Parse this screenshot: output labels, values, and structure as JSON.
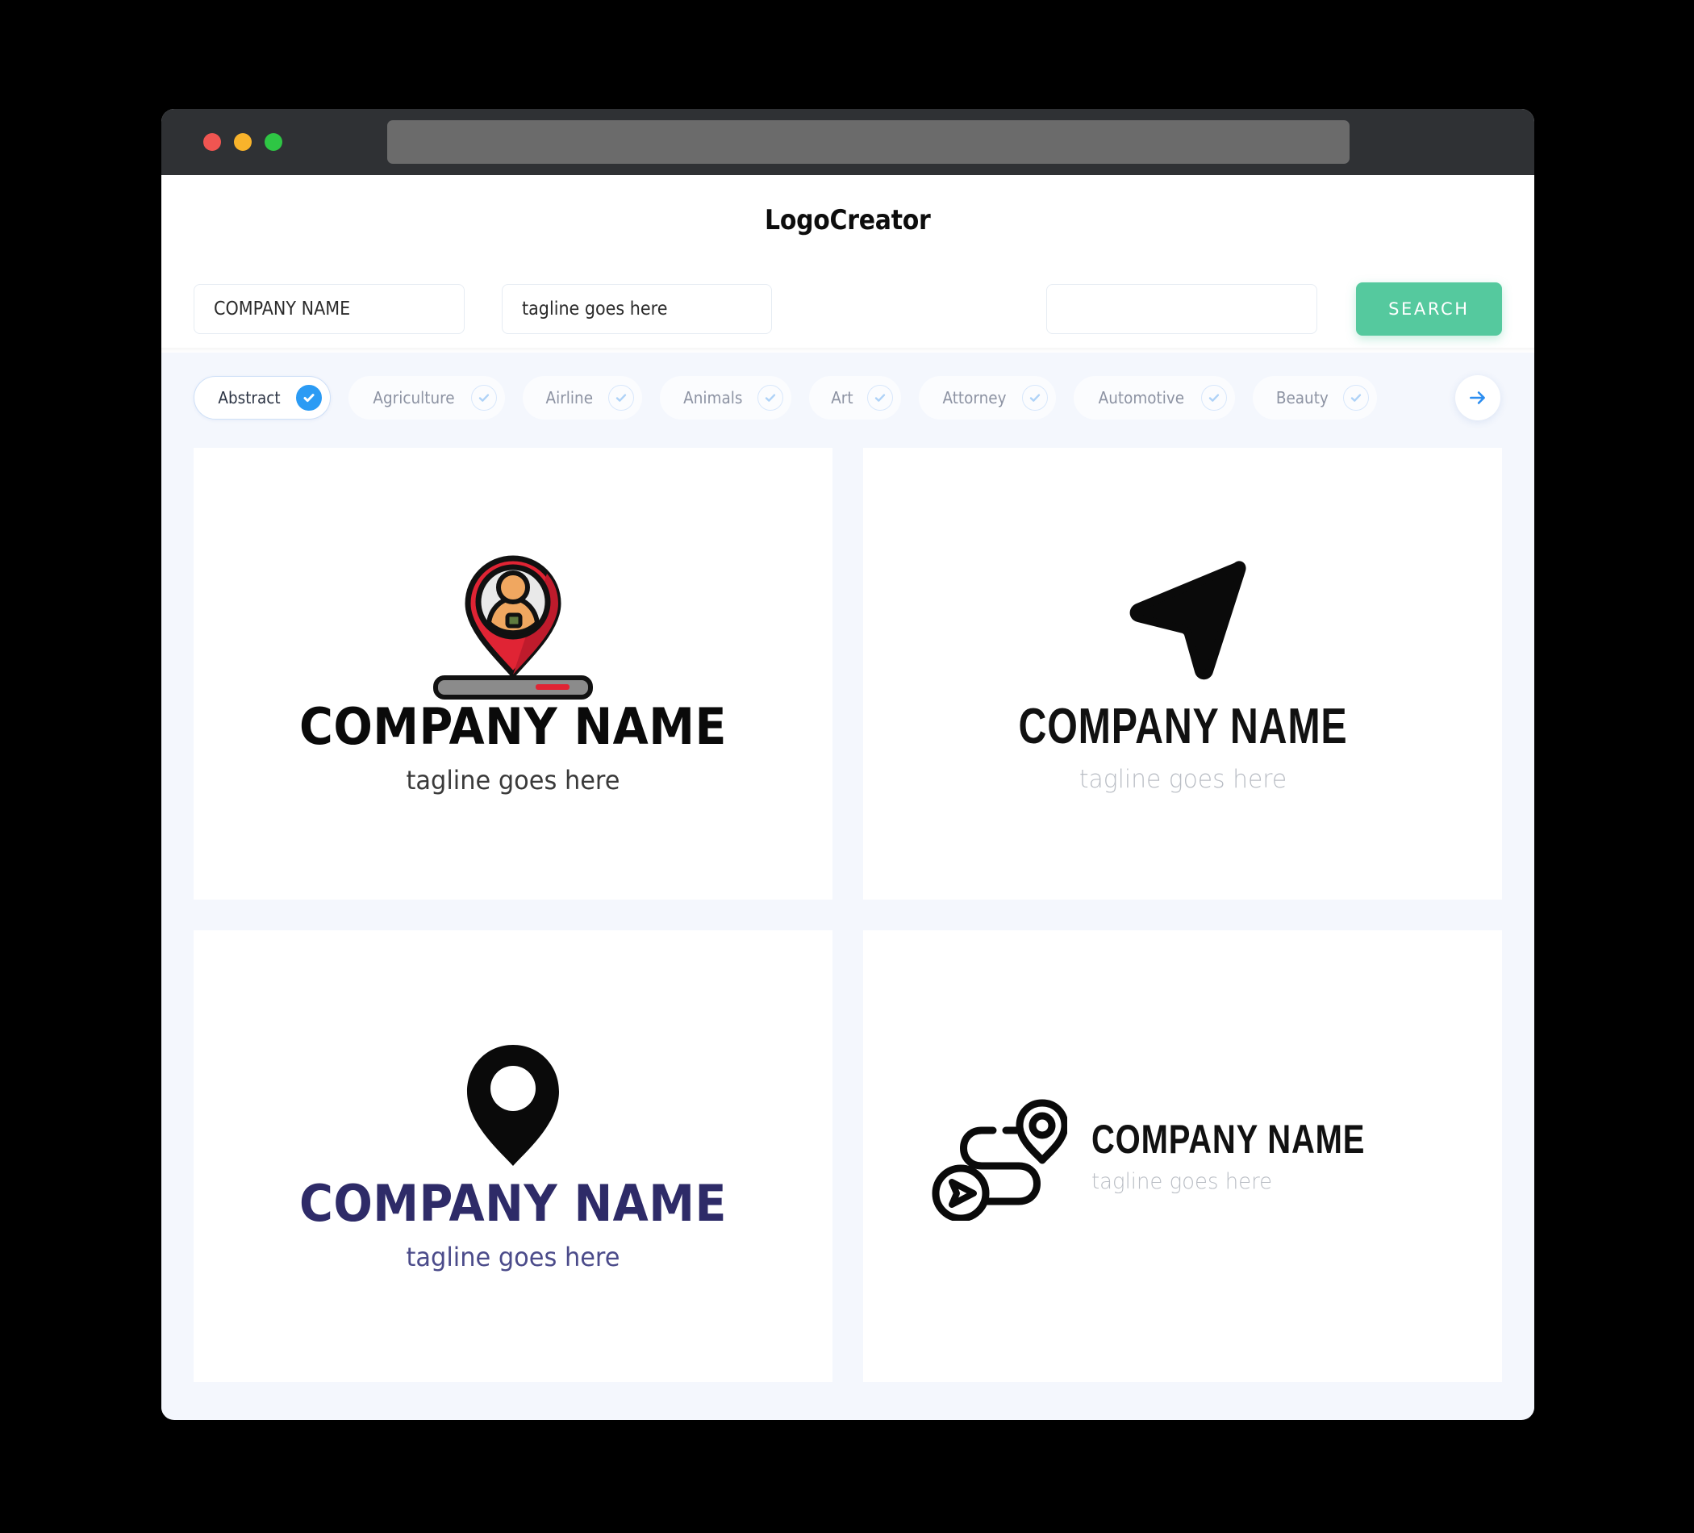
{
  "window": {
    "traffic_lights": [
      "close",
      "minimize",
      "maximize"
    ],
    "url_value": ""
  },
  "header": {
    "title": "LogoCreator"
  },
  "search": {
    "company_value": "COMPANY NAME",
    "company_placeholder": "COMPANY NAME",
    "tagline_value": "tagline goes here",
    "tagline_placeholder": "tagline goes here",
    "extra_value": "",
    "extra_placeholder": "",
    "button_label": "SEARCH",
    "button_color": "#55c99e"
  },
  "categories": {
    "items": [
      {
        "label": "Abstract",
        "selected": true
      },
      {
        "label": "Agriculture",
        "selected": false
      },
      {
        "label": "Airline",
        "selected": false
      },
      {
        "label": "Animals",
        "selected": false
      },
      {
        "label": "Art",
        "selected": false
      },
      {
        "label": "Attorney",
        "selected": false
      },
      {
        "label": "Automotive",
        "selected": false
      },
      {
        "label": "Beauty",
        "selected": false
      }
    ],
    "next_label": "next-categories",
    "selected_accent": "#2b9bf4",
    "unselected_check": "#aed2f7"
  },
  "results": {
    "cards": [
      {
        "icon": "map-pin-person-icon",
        "company": "COMPANY NAME",
        "tagline": "tagline goes here",
        "text_color": "#0a0a0a",
        "tagline_color": "#3a3a3a",
        "layout": "stacked"
      },
      {
        "icon": "navigation-cursor-icon",
        "company": "COMPANY NAME",
        "tagline": "tagline goes here",
        "text_color": "#111111",
        "tagline_color": "#b9bdc4",
        "layout": "stacked"
      },
      {
        "icon": "map-pin-solid-icon",
        "company": "COMPANY NAME",
        "tagline": "tagline goes here",
        "text_color": "#2e2b68",
        "tagline_color": "#4b4b8a",
        "layout": "stacked"
      },
      {
        "icon": "route-path-icon",
        "company": "COMPANY NAME",
        "tagline": "tagline goes here",
        "text_color": "#111111",
        "tagline_color": "#b9bdc4",
        "layout": "horizontal"
      }
    ]
  }
}
